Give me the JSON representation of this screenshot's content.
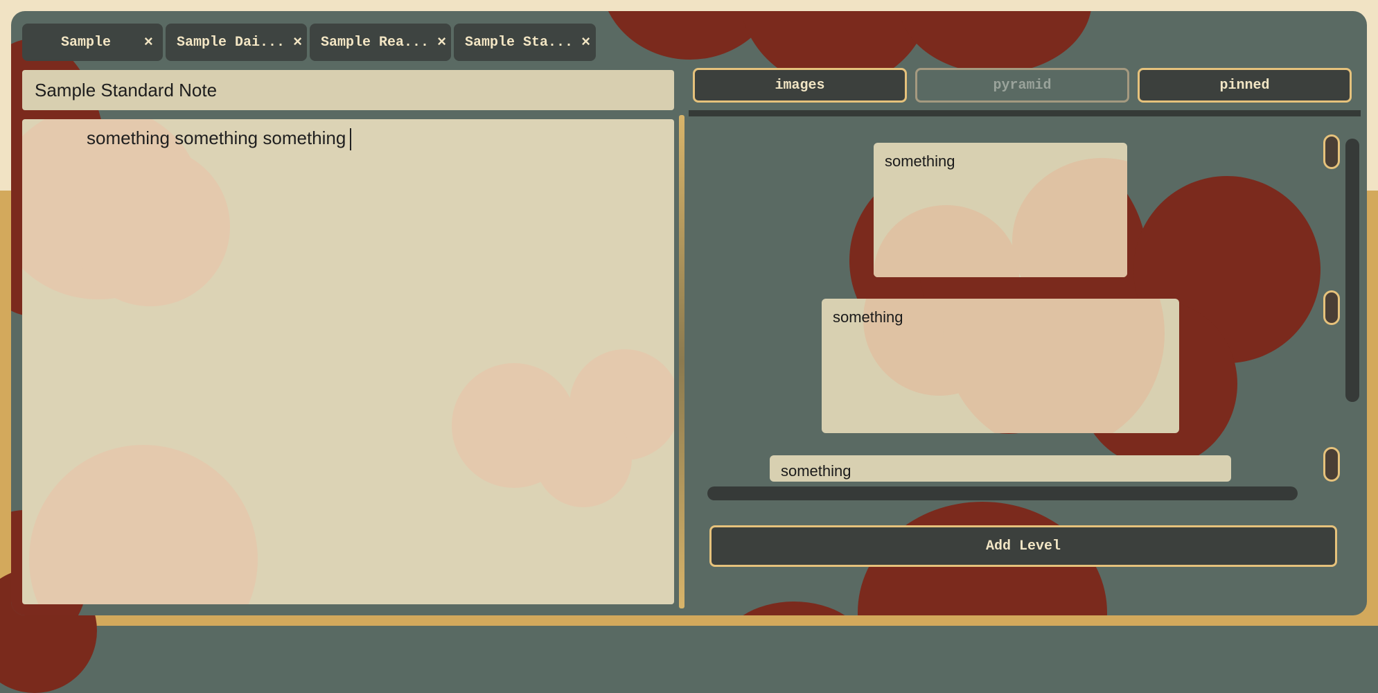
{
  "tabs": [
    {
      "label": "Sample"
    },
    {
      "label": "Sample Dai..."
    },
    {
      "label": "Sample Rea..."
    },
    {
      "label": "Sample Sta..."
    }
  ],
  "tab_close_glyph": "×",
  "note": {
    "title": "Sample Standard Note",
    "body": "something something something"
  },
  "view_tabs": [
    {
      "label": "images",
      "active": true
    },
    {
      "label": "pyramid",
      "active": false
    },
    {
      "label": "pinned",
      "active": true
    }
  ],
  "pyramid": {
    "levels": [
      {
        "text": "something"
      },
      {
        "text": "something"
      },
      {
        "text": "something"
      }
    ]
  },
  "add_level_label": "Add Level",
  "colors": {
    "background": "#596a63",
    "accent": "#e6c27c",
    "button": "#3c403d",
    "paper": "#dcd3b5",
    "blob": "#7b2a1d"
  }
}
